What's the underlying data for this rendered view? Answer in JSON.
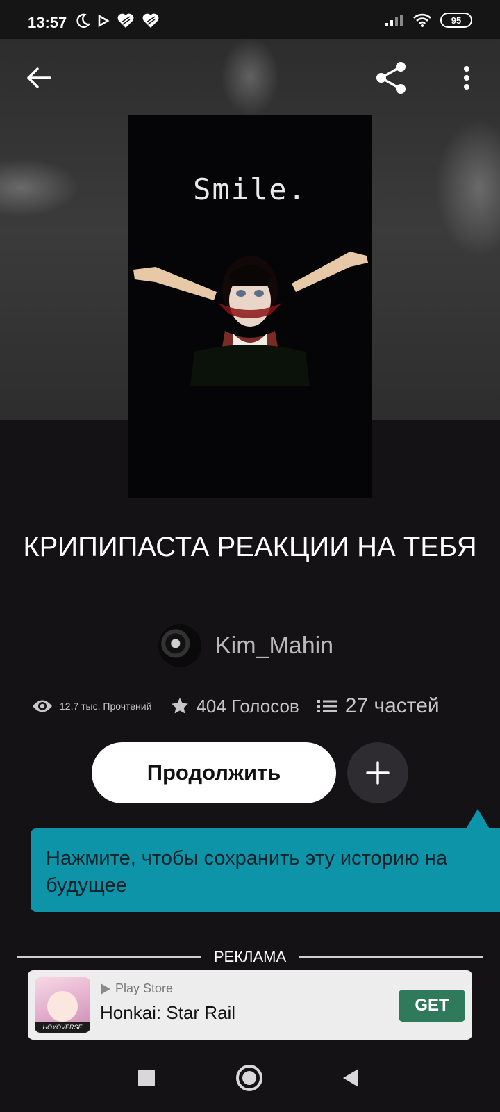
{
  "status_bar": {
    "time": "13:57",
    "battery": "95",
    "left_icons": [
      "moon-icon",
      "play-icon",
      "heart-icon",
      "heart-icon"
    ],
    "right_icons": [
      "signal-icon",
      "wifi-icon",
      "battery-icon"
    ]
  },
  "app_bar": {
    "back_icon": "arrow-left-icon",
    "share_icon": "share-icon",
    "more_icon": "more-vertical-icon"
  },
  "cover": {
    "title": "Smile."
  },
  "story": {
    "title": "КРИПИПАСТА РЕАКЦИИ НА ТЕБЯ",
    "author": "Kim_Mahin"
  },
  "stats": {
    "reads": "12,7 тыс. Прочтений",
    "votes": "404 Голосов",
    "parts": "27 частей"
  },
  "actions": {
    "continue_label": "Продолжить",
    "add_icon": "plus-icon"
  },
  "tooltip": {
    "text": "Нажмите, чтобы сохранить эту историю на будущее"
  },
  "ad": {
    "label": "РЕКЛАМА",
    "store": "Play Store",
    "app_name": "Honkai: Star Rail",
    "get_label": "GET",
    "icon_brand": "HOYOVERSE"
  },
  "nav": {
    "icons": [
      "recents-square-icon",
      "home-circle-icon",
      "back-triangle-icon"
    ]
  },
  "colors": {
    "background": "#141215",
    "tooltip": "#0d94a8",
    "get_button": "#2f7a5a"
  }
}
